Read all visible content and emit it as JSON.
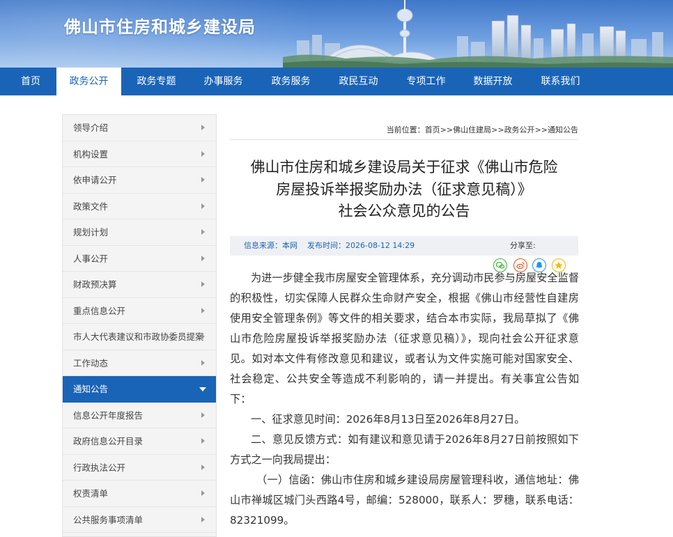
{
  "site": {
    "title": "佛山市住房和城乡建设局"
  },
  "nav": {
    "items": [
      {
        "label": "首页"
      },
      {
        "label": "政务公开"
      },
      {
        "label": "政务专题"
      },
      {
        "label": "办事服务"
      },
      {
        "label": "政务服务"
      },
      {
        "label": "政民互动"
      },
      {
        "label": "专项工作"
      },
      {
        "label": "数据开放"
      },
      {
        "label": "联系我们"
      }
    ],
    "active_index": 1
  },
  "sidebar": {
    "items": [
      {
        "label": "领导介绍"
      },
      {
        "label": "机构设置"
      },
      {
        "label": "依申请公开"
      },
      {
        "label": "政策文件"
      },
      {
        "label": "规划计划"
      },
      {
        "label": "人事公开"
      },
      {
        "label": "财政预决算"
      },
      {
        "label": "重点信息公开"
      },
      {
        "label": "市人大代表建议和市政协委员提案"
      },
      {
        "label": "工作动态"
      },
      {
        "label": "通知公告"
      },
      {
        "label": "信息公开年度报告"
      },
      {
        "label": "政府信息公开目录"
      },
      {
        "label": "行政执法公开"
      },
      {
        "label": "权责清单"
      },
      {
        "label": "公共服务事项清单"
      }
    ],
    "active_index": 10
  },
  "breadcrumb": {
    "prefix": "当前位置：",
    "items": [
      "首页",
      "佛山住建局",
      "政务公开",
      "通知公告"
    ],
    "separator": ">>"
  },
  "article": {
    "title_lines": [
      "佛山市住房和城乡建设局关于征求《佛山市危险",
      "房屋投诉举报奖励办法（征求意见稿）》",
      "社会公众意见的公告"
    ],
    "source_label": "信息来源：本网",
    "date_label": "发布时间：2026-08-12 14:29",
    "share_label": "分享至:",
    "share_icons": [
      "wechat-icon",
      "weibo-icon",
      "qq-icon",
      "qzone-icon"
    ],
    "paragraphs": [
      "为进一步健全我市房屋安全管理体系，充分调动市民参与房屋安全监督的积极性，切实保障人民群众生命财产安全，根据《佛山市经营性自建房使用安全管理条例》等文件的相关要求，结合本市实际，我局草拟了《佛山市危险房屋投诉举报奖励办法（征求意见稿）》，现向社会公开征求意见。如对本文件有修改意见和建议，或者认为文件实施可能对国家安全、社会稳定、公共安全等造成不利影响的，请一并提出。有关事宜公告如下：",
      "一、征求意见时间：2026年8月13日至2026年8月27日。",
      "二、意见反馈方式：如有建议和意见请于2026年8月27日前按照如下方式之一向我局提出：",
      "（一）信函：佛山市住房和城乡建设局房屋管理科收，通信地址：佛山市禅城区城门头西路4号，邮编：528000，联系人：罗穗，联系电话：82321099。"
    ]
  },
  "colors": {
    "brand_blue": "#1a64b8",
    "banner_top": "#3f78c9",
    "infobar": "#eef0f4"
  }
}
